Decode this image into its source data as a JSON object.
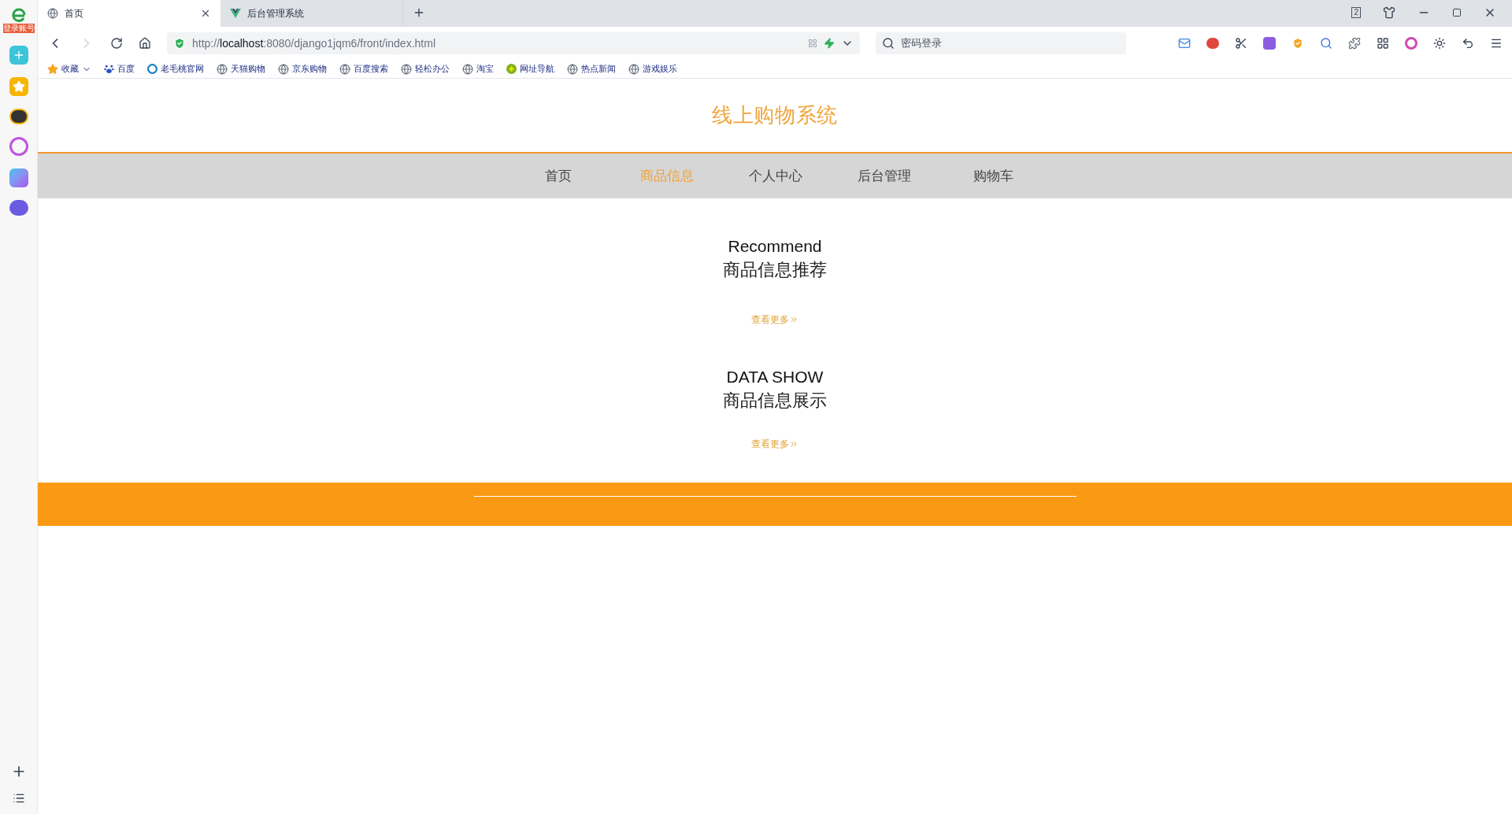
{
  "browser": {
    "login_badge": "登录账号",
    "tabs": [
      {
        "label": "首页",
        "selected": true,
        "kind": "globe"
      },
      {
        "label": "后台管理系统",
        "selected": false,
        "kind": "vue"
      }
    ],
    "window_count": "2",
    "address": {
      "prefix": "http://",
      "host": "localhost",
      "rest": ":8080/django1jqm6/front/index.html"
    },
    "search": {
      "placeholder": "密码登录"
    },
    "bookmarks": [
      {
        "label": "收藏",
        "kind": "star"
      },
      {
        "label": "百度",
        "kind": "paw"
      },
      {
        "label": "老毛桃官网",
        "kind": "ring"
      },
      {
        "label": "天猫购物",
        "kind": "globe"
      },
      {
        "label": "京东购物",
        "kind": "globe"
      },
      {
        "label": "百度搜索",
        "kind": "globe"
      },
      {
        "label": "轻松办公",
        "kind": "globe"
      },
      {
        "label": "淘宝",
        "kind": "globe"
      },
      {
        "label": "网址导航",
        "kind": "plus"
      },
      {
        "label": "热点新闻",
        "kind": "globe"
      },
      {
        "label": "游戏娱乐",
        "kind": "globe"
      }
    ]
  },
  "page": {
    "title": "线上购物系统",
    "nav": [
      {
        "label": "首页",
        "selected": false
      },
      {
        "label": "商品信息",
        "selected": true
      },
      {
        "label": "个人中心",
        "selected": false
      },
      {
        "label": "后台管理",
        "selected": false
      },
      {
        "label": "购物车",
        "selected": false
      }
    ],
    "sections": [
      {
        "subtitle": "Recommend",
        "title": "商品信息推荐",
        "more": "查看更多"
      },
      {
        "subtitle": "DATA SHOW",
        "title": "商品信息展示",
        "more": "查看更多"
      }
    ]
  }
}
